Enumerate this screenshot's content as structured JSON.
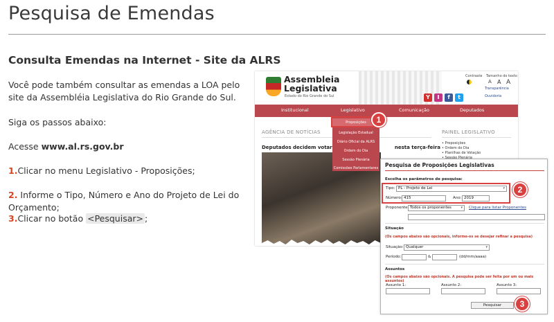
{
  "page": {
    "title": "Pesquisa de Emendas",
    "heading": "Consulta Emendas na Internet - Site da ALRS",
    "intro": "Você pode também consultar as emendas a LOA pelo site da Assembléia Legislativa do Rio Grande do Sul.",
    "steps_intro": "Siga os passos abaixo:",
    "access_prefix": "Acesse ",
    "access_url": "www.al.rs.gov.br",
    "steps": [
      {
        "num": "1.",
        "text": "Clicar no menu Legislativo - Proposições;"
      },
      {
        "num": "2.",
        "text": " Informe o Tipo, Número e Ano do Projeto de Lei do Orçamento;"
      },
      {
        "num": "3.",
        "text_before": "Clicar no botão ",
        "code": "<Pesquisar>",
        "text_after": ";"
      }
    ]
  },
  "site": {
    "logo_title": "Assembleia Legislativa",
    "logo_sub": "Estado do Rio Grande do Sul",
    "contraste": "Contraste",
    "tamanho": "Tamanho do texto",
    "font_sizes": [
      "A",
      "A",
      "A"
    ],
    "transparencia": "Transparência",
    "ouvidoria": "Ouvidoria",
    "social": [
      "Y",
      "I",
      "f",
      "t"
    ],
    "nav": [
      "Institucional",
      "Legislativo",
      "Comunicação",
      "Deputados"
    ],
    "dropdown": [
      "Proposições",
      "Legislação Estadual",
      "Diário Oficial da ALRS",
      "Ordem do Dia",
      "Sessão Plenária",
      "Comissões Parlamentares"
    ],
    "agencia": "AGÊNCIA DE NOTÍCIAS",
    "headline": "Deputados decidem votar três",
    "headline_tail": "nesta terça-feira",
    "painel": "PAINEL LEGISLATIVO",
    "painel_items": [
      "• Proposições",
      "• Ordem do Dia",
      "• Planilhas de Votação",
      "• Sessão Plenária"
    ]
  },
  "form": {
    "title": "Pesquisa de Proposições Legislativas",
    "params_label": "Escolha os parâmetros de pesquisa:",
    "tipo_label": "Tipo:",
    "tipo_value": "PL - Projeto de Lei",
    "numero_label": "Número:",
    "numero_value": "415",
    "ano_label": "Ano:",
    "ano_value": "2019",
    "proponente_label": "Proponente:",
    "proponente_value": "Todos os proponentes",
    "proponente_link": "Clique para listar Proponentes",
    "situacao_title": "Situação",
    "situacao_note": "(Os campos abaixo são opcionais, informe-os se desejar refinar a pesquisa)",
    "situacao_label": "Situação:",
    "situacao_value": "Qualquer",
    "periodo_label": "Período:",
    "periodo_sep": "&",
    "periodo_hint": "(dd/mm/aaaa)",
    "assuntos_title": "Assuntos",
    "assuntos_note": "(Os campos abaixo são opcionais. A pesquisa pode ser feita por um ou mais assuntos)",
    "assunto1": "Assunto 1:",
    "assunto2": "Assunto 2:",
    "assunto3": "Assunto 3:",
    "button": "Pesquisar"
  },
  "badges": [
    "1",
    "2",
    "3"
  ],
  "colors": {
    "accent": "#d94040",
    "nav": "#b9474d",
    "step_number": "#d9441e"
  }
}
